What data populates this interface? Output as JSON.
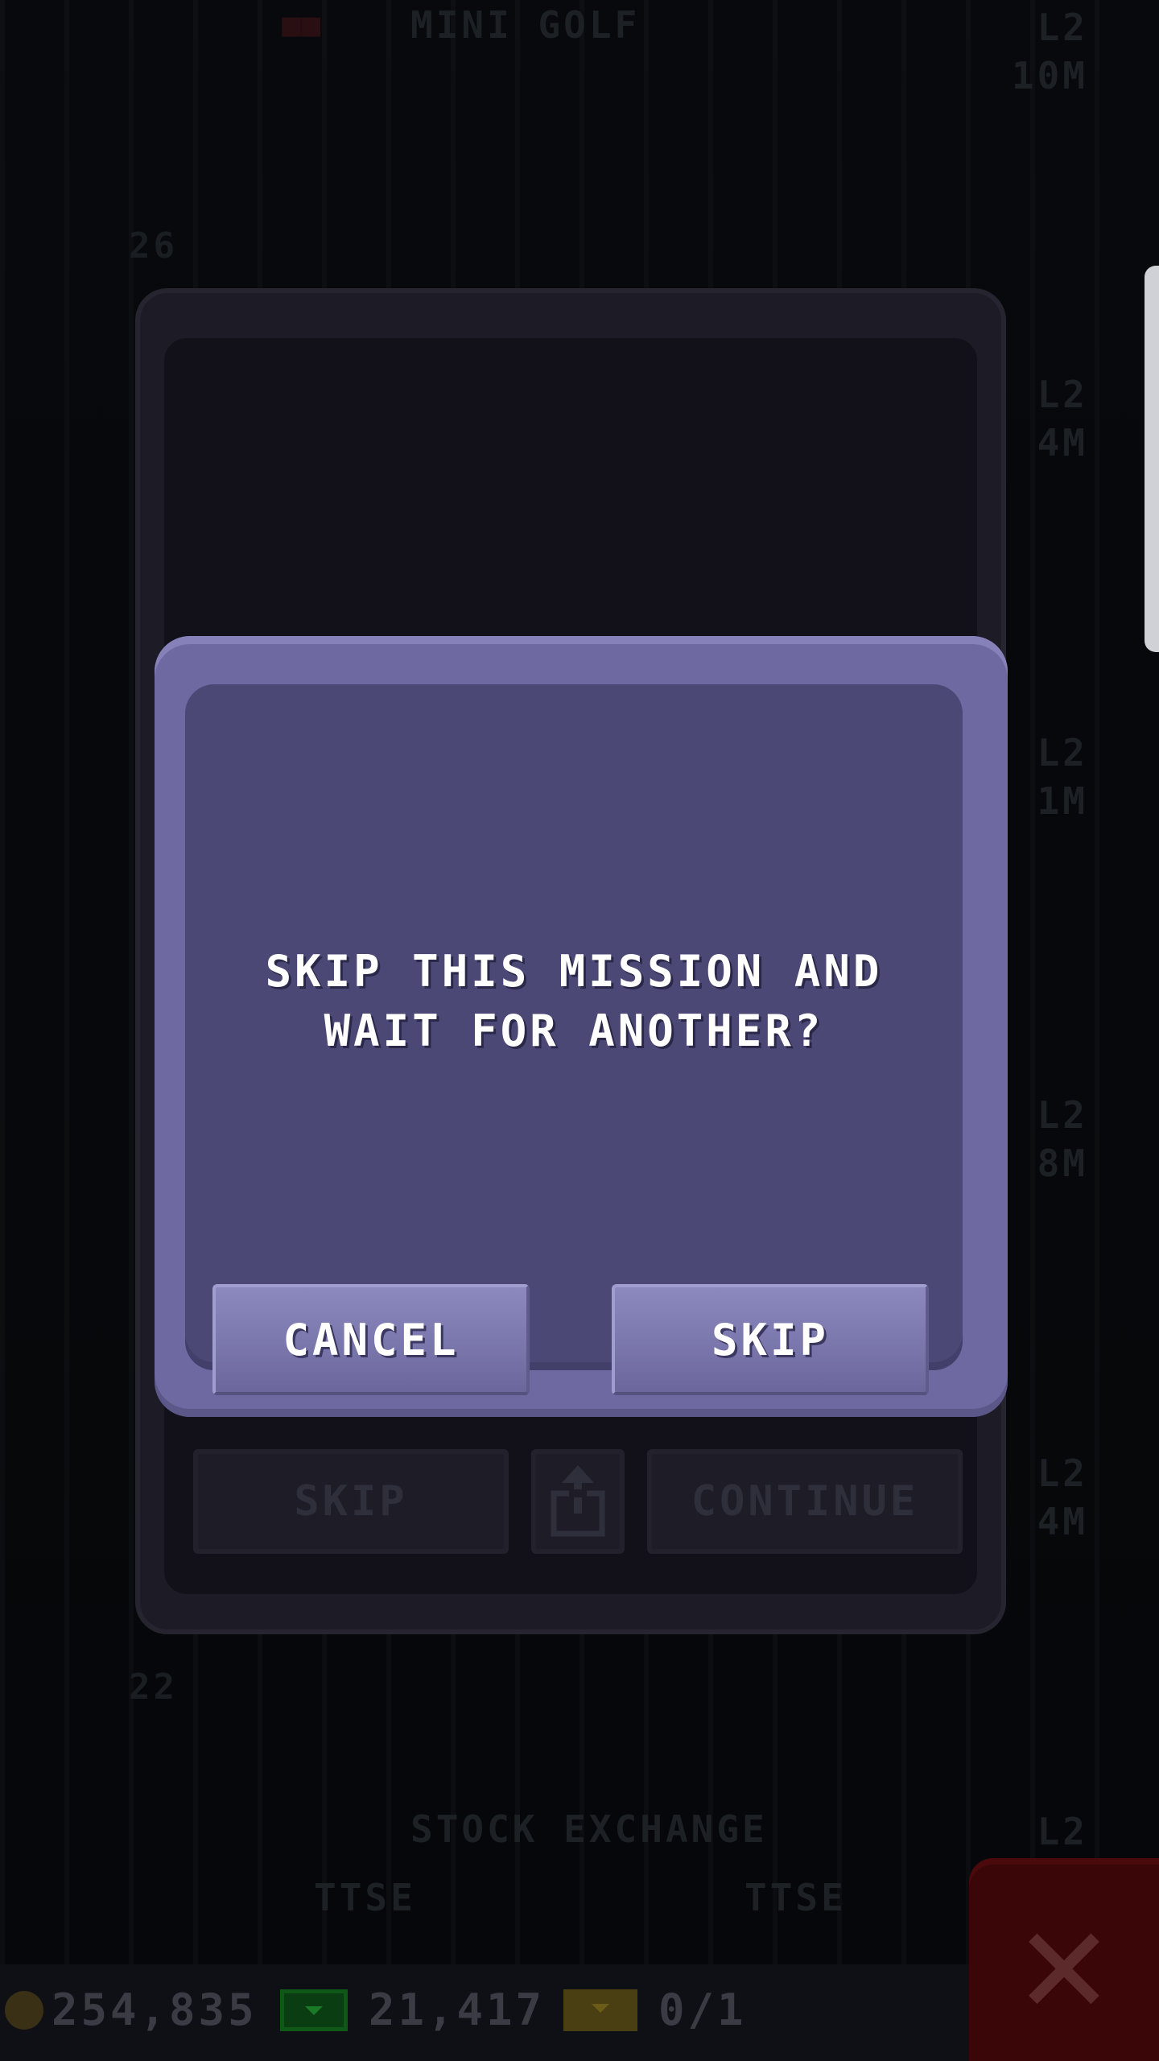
{
  "background": {
    "floors": [
      {
        "name": "MINI GOLF",
        "level": "L2",
        "value": "10M",
        "number": "26"
      },
      {
        "name": "",
        "level": "L2",
        "value": "4M",
        "number": ""
      },
      {
        "name": "",
        "level": "L2",
        "value": "1M",
        "number": ""
      },
      {
        "name": "",
        "level": "L2",
        "value": "8M",
        "number": ""
      },
      {
        "name": "",
        "level": "L2",
        "value": "4M",
        "number": "22"
      },
      {
        "name": "STOCK EXCHANGE",
        "level": "L2",
        "value": "",
        "number": ""
      }
    ],
    "stock_labels": [
      "TTSE",
      "TTSE"
    ]
  },
  "back_card": {
    "skip_label": "SKIP",
    "continue_label": "CONTINUE",
    "share_icon": "share-icon"
  },
  "dialog": {
    "message": "SKIP THIS MISSION AND WAIT FOR ANOTHER?",
    "cancel_label": "CANCEL",
    "skip_label": "SKIP"
  },
  "bottom_bar": {
    "coins": "254,835",
    "bux": "21,417",
    "tickets": "0/1",
    "icons": [
      "coin-icon",
      "bux-icon",
      "ticket-icon",
      "close-icon"
    ]
  },
  "colors": {
    "dialog_frame": "#6e6aa1",
    "dialog_inner": "#4b4876",
    "button": "#7a77ad",
    "close_box": "#3a0608"
  }
}
